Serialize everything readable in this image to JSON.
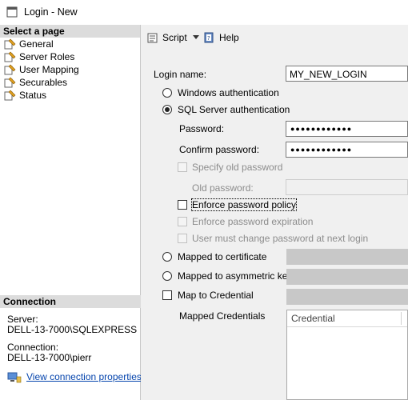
{
  "window": {
    "title": "Login - New"
  },
  "sidebar": {
    "header": "Select a page",
    "items": [
      {
        "label": "General"
      },
      {
        "label": "Server Roles"
      },
      {
        "label": "User Mapping"
      },
      {
        "label": "Securables"
      },
      {
        "label": "Status"
      }
    ]
  },
  "connection": {
    "header": "Connection",
    "server_label": "Server:",
    "server_value": "DELL-13-7000\\SQLEXPRESS",
    "connection_label": "Connection:",
    "connection_value": "DELL-13-7000\\pierr",
    "properties_link": "View connection properties"
  },
  "toolbar": {
    "script_label": "Script",
    "help_label": "Help"
  },
  "form": {
    "login_name_label": "Login name:",
    "login_name_value": "MY_NEW_LOGIN",
    "windows_auth_label": "Windows authentication",
    "sql_auth_label": "SQL Server authentication",
    "password_label": "Password:",
    "password_value": "●●●●●●●●●●●●",
    "confirm_password_label": "Confirm password:",
    "confirm_password_value": "●●●●●●●●●●●●",
    "specify_old_label": "Specify old password",
    "old_password_label": "Old password:",
    "enforce_policy_label": "Enforce password policy",
    "enforce_expiration_label": "Enforce password expiration",
    "must_change_label": "User must change password at next login",
    "mapped_cert_label": "Mapped to certificate",
    "mapped_asym_label": "Mapped to asymmetric key",
    "map_credential_label": "Map to Credential",
    "mapped_credentials_label": "Mapped Credentials",
    "grid_column_credential": "Credential"
  },
  "colors": {
    "link": "#0645ad",
    "panel_bg": "#f0f0f0",
    "header_bg": "#dcdcdc"
  }
}
